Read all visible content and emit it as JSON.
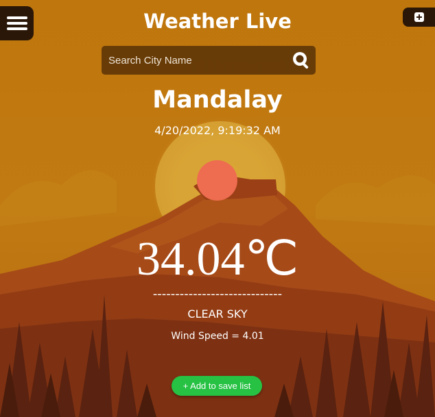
{
  "app": {
    "title": "Weather Live"
  },
  "header": {
    "menu_icon": "hamburger-menu-icon",
    "add_icon": "plus-square-icon"
  },
  "search": {
    "placeholder": "Search City Name",
    "value": "",
    "icon": "search-magnifier-icon"
  },
  "weather": {
    "city": "Mandalay",
    "datetime": "4/20/2022, 9:19:32 AM",
    "icon": "clear-sky-sun-icon",
    "temperature": "34.04℃",
    "divider": "-----------------------------",
    "condition": "CLEAR SKY",
    "wind_label": "Wind Speed = ",
    "wind_value": "4.01"
  },
  "actions": {
    "save_label": "+ Add to save list"
  },
  "colors": {
    "sky_top": "#c1780e",
    "sun": "#d4a52e",
    "mountain": "#9a4215",
    "trees": "#5a2210",
    "weather_icon": "#ee6c50",
    "save_button": "#27c244",
    "panel_dark": "#2b1708"
  }
}
